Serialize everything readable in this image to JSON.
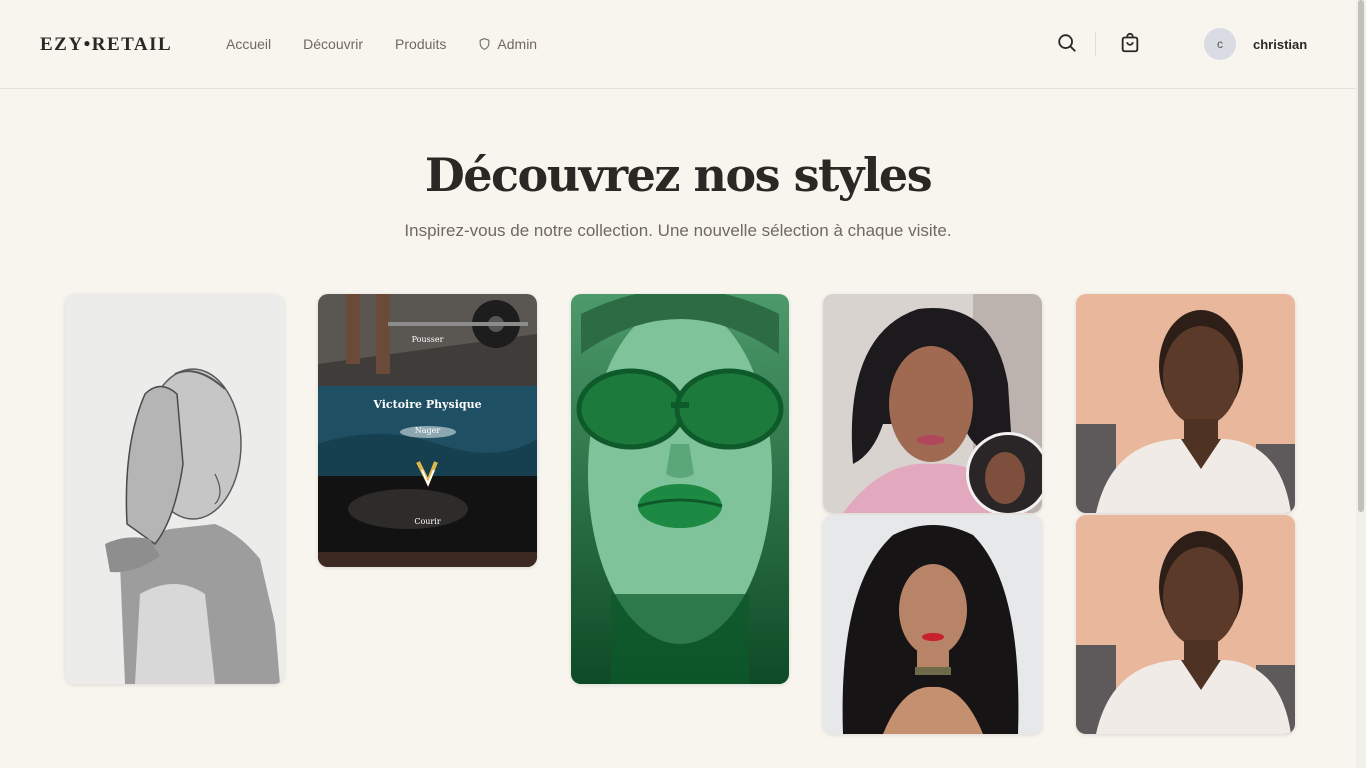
{
  "header": {
    "logo": "EZY•RETAIL",
    "nav": [
      {
        "label": "Accueil"
      },
      {
        "label": "Découvrir"
      },
      {
        "label": "Produits"
      },
      {
        "label": "Admin",
        "icon": "shield-icon"
      }
    ],
    "search_icon": "search-icon",
    "cart_icon": "shopping-bag-icon",
    "avatar_initial": "c",
    "username": "christian"
  },
  "hero": {
    "title": "Découvrez nos styles",
    "subtitle": "Inspirez-vous de notre collection. Une nouvelle sélection à chaque visite."
  },
  "gallery": {
    "poster": {
      "top": "Pousser",
      "heading": "Victoire Physique",
      "middle": "Nager",
      "bottom": "Courir"
    }
  },
  "colors": {
    "background": "#f8f5ef",
    "text": "#2b2724",
    "muted": "#6f6962"
  }
}
